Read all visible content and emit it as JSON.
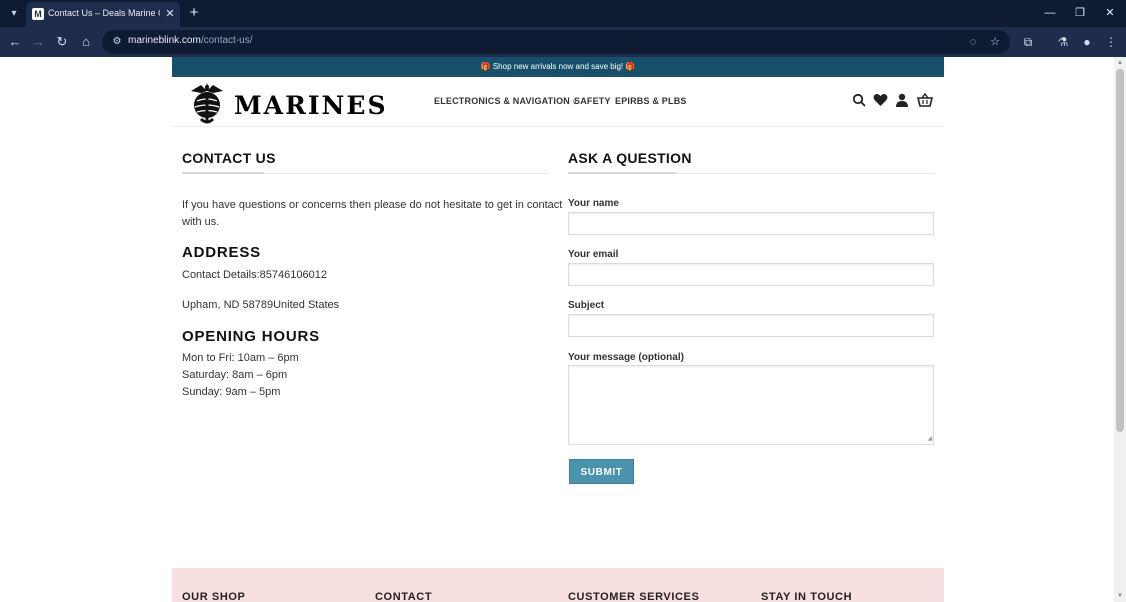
{
  "browser": {
    "tab_title": "Contact Us – Deals Marine Com",
    "tab_favicon_letter": "M",
    "url_domain": "marineblink.com",
    "url_path": "/contact-us/"
  },
  "promo": {
    "text": "Shop new arrivals now and save big!",
    "gift_icon": "🎁"
  },
  "header": {
    "logo_text": "MARINES",
    "nav": [
      {
        "label": "ELECTRONICS & NAVIGATION",
        "has_dropdown": true
      },
      {
        "label": "SAFETY"
      },
      {
        "label": "EPIRBS & PLBS"
      }
    ],
    "icons": [
      "search-icon",
      "heart-icon",
      "user-icon",
      "basket-icon"
    ]
  },
  "contact": {
    "title": "CONTACT US",
    "intro_line1": "If you have questions or concerns then please do not hesitate to get in contact",
    "intro_line2": "with us.",
    "address_heading": "ADDRESS",
    "contact_details": "Contact Details:85746106012",
    "address": "Upham, ND 58789United States",
    "hours_heading": "OPENING HOURS",
    "hours": [
      "Mon to Fri: 10am – 6pm",
      "Saturday: 8am – 6pm",
      "Sunday: 9am – 5pm"
    ]
  },
  "form": {
    "title": "ASK A QUESTION",
    "name_label": "Your name",
    "email_label": "Your email",
    "subject_label": "Subject",
    "message_label": "Your message (optional)",
    "name_value": "",
    "email_value": "",
    "subject_value": "",
    "message_value": "",
    "submit_label": "SUBMIT"
  },
  "footer": {
    "columns": [
      "OUR SHOP",
      "CONTACT",
      "CUSTOMER SERVICES",
      "STAY IN TOUCH"
    ]
  },
  "colors": {
    "promo_bg": "#17506b",
    "submit_bg": "#4a93ad",
    "footer_bg": "#f6e0e0",
    "chrome_dark": "#0f1b33",
    "chrome_toolbar": "#1f2d4d"
  }
}
